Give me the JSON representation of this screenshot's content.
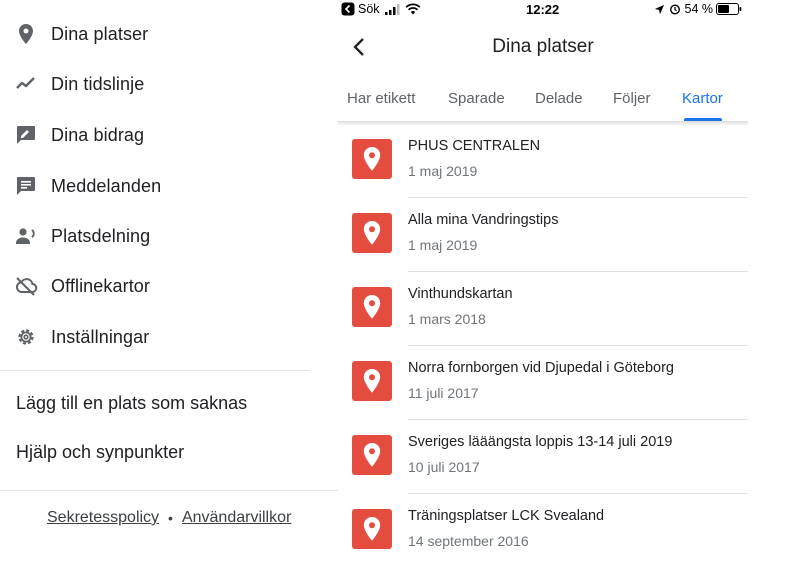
{
  "drawer": {
    "menu": [
      {
        "label": "Dina platser",
        "icon": "location-pin-icon"
      },
      {
        "label": "Din tidslinje",
        "icon": "timeline-icon"
      },
      {
        "label": "Dina bidrag",
        "icon": "contributions-icon"
      },
      {
        "label": "Meddelanden",
        "icon": "message-icon"
      },
      {
        "label": "Platsdelning",
        "icon": "location-sharing-icon"
      },
      {
        "label": "Offlinekartor",
        "icon": "cloud-off-icon"
      },
      {
        "label": "Inställningar",
        "icon": "gear-icon"
      }
    ],
    "add_place": "Lägg till en plats som saknas",
    "help": "Hjälp och synpunkter",
    "footer": {
      "privacy": "Sekretesspolicy",
      "separator": "•",
      "terms": "Användarvillkor"
    }
  },
  "phone": {
    "statusbar": {
      "back_app": "Sök",
      "time": "12:22",
      "battery": "54 %"
    },
    "title": "Dina platser",
    "tabs": [
      {
        "label": "Har etikett",
        "active": false
      },
      {
        "label": "Sparade",
        "active": false
      },
      {
        "label": "Delade",
        "active": false
      },
      {
        "label": "Följer",
        "active": false
      },
      {
        "label": "Kartor",
        "active": true
      }
    ],
    "maps": [
      {
        "title": "PHUS CENTRALEN",
        "date": "1 maj 2019"
      },
      {
        "title": "Alla mina Vandringstips",
        "date": "1 maj 2019"
      },
      {
        "title": "Vinthundskartan",
        "date": "1 mars 2018"
      },
      {
        "title": "Norra fornborgen vid Djupedal i Göteborg",
        "date": "11 juli 2017"
      },
      {
        "title": "Sveriges lääängsta loppis 13-14 juli 2019",
        "date": "10 juli 2017"
      },
      {
        "title": "Träningsplatser LCK Svealand",
        "date": "14 september 2016"
      }
    ]
  },
  "colors": {
    "accent": "#1a73e8",
    "map_icon": "#e34c3f",
    "icon_grey": "#5f6368"
  }
}
